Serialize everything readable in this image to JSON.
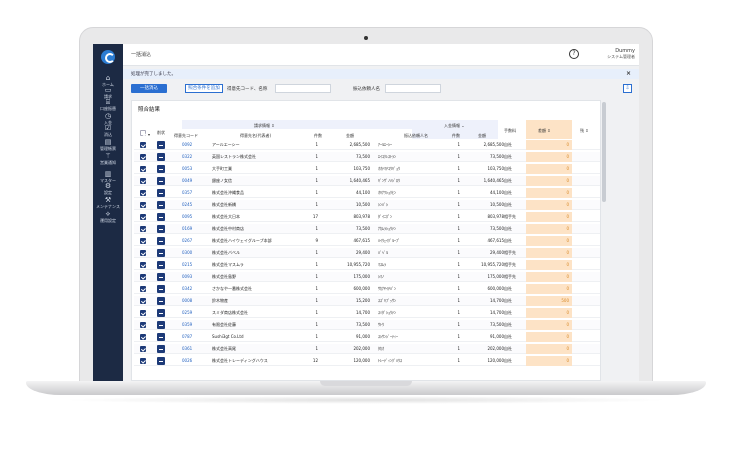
{
  "header": {
    "title": "一括消込",
    "user_name": "Dummy",
    "user_role": "システム管理者",
    "help_icon": "?"
  },
  "sidebar": [
    {
      "icon": "home-icon",
      "glyph": "⌂",
      "label": "ホーム"
    },
    {
      "icon": "invoice-icon",
      "glyph": "▭",
      "label": "請求"
    },
    {
      "icon": "bank-icon",
      "glyph": "⌸",
      "label": "口座振替"
    },
    {
      "icon": "deposit-icon",
      "glyph": "◷",
      "label": "入金"
    },
    {
      "icon": "clear-icon",
      "glyph": "☑",
      "label": "消込"
    },
    {
      "icon": "ledger-icon",
      "glyph": "▤",
      "label": "管理帳票"
    },
    {
      "icon": "notice-icon",
      "glyph": "⚚",
      "label": "営業通知"
    },
    {
      "icon": "master-icon",
      "glyph": "▥",
      "label": "マスター"
    },
    {
      "icon": "settings-icon",
      "glyph": "⚙",
      "label": "設定"
    },
    {
      "icon": "maintenance-icon",
      "glyph": "⚒",
      "label": "メンテナンス"
    },
    {
      "icon": "ops-icon",
      "glyph": "⟡",
      "label": "運用設定"
    }
  ],
  "alert": {
    "message": "処理が完了しました。",
    "close": "×"
  },
  "toolbar": {
    "bulk_clear": "一括消込",
    "add_condition": "照合条件を追加",
    "customer_label": "得意先コード、名称",
    "payer_label": "振込依頼人名",
    "download_icon": "⇩"
  },
  "results": {
    "title": "照合結果",
    "group_request": "請求情報 ⇕",
    "group_deposit": "入金情報 ⌄",
    "columns": {
      "select": "",
      "status": "削状",
      "code": "得意先コード",
      "name": "得意先名(代表者)",
      "count": "件数",
      "amount": "金額",
      "payer": "振込依頼人名",
      "dep_count": "件数",
      "dep_amount": "金額",
      "fee": "手数料",
      "diff": "差額 ⇕",
      "extra": "残 ⇕"
    },
    "rows": [
      {
        "code": "0092",
        "name": "アールエーシー",
        "count": "1",
        "amount": "2,685,500",
        "payer": "ｱｰﾙｴｰｼｰ",
        "dep_count": "1",
        "dep_amount": "2,685,500",
        "fee": "自社",
        "diff": "0"
      },
      {
        "code": "0322",
        "name": "英国レストラン株式会社",
        "count": "1",
        "amount": "73,500",
        "payer": "ｴｲｺｸﾚｽﾄﾗﾝ",
        "dep_count": "1",
        "dep_amount": "73,500",
        "fee": "自社",
        "diff": "0"
      },
      {
        "code": "0053",
        "name": "大手町工業",
        "count": "1",
        "amount": "103,750",
        "payer": "ｵｵﾃﾏﾁｺｳｷﾞｮｳ",
        "dep_count": "1",
        "dep_amount": "103,750",
        "fee": "自社",
        "diff": "0"
      },
      {
        "code": "0049",
        "name": "銀座ノ女信",
        "count": "1",
        "amount": "1,640,465",
        "payer": "ｷﾞﾝｻﾞﾉﾒｼﾞﾛｳ",
        "dep_count": "1",
        "dep_amount": "1,640,465",
        "fee": "自社",
        "diff": "0"
      },
      {
        "code": "0357",
        "name": "株式会社沖縄食品",
        "count": "1",
        "amount": "44,100",
        "payer": "ｵｷﾅﾜｼｮｸﾋﾝ",
        "dep_count": "1",
        "dep_amount": "44,100",
        "fee": "自社",
        "diff": "0"
      },
      {
        "code": "0245",
        "name": "株式会社新橋",
        "count": "1",
        "amount": "10,500",
        "payer": "ｼﾝﾊﾞｼ",
        "dep_count": "1",
        "dep_amount": "10,500",
        "fee": "自社",
        "diff": "0"
      },
      {
        "code": "0095",
        "name": "株式会社大日本",
        "count": "17",
        "amount": "803,978",
        "payer": "ﾀﾞｲﾆﾎﾟﾝ",
        "dep_count": "1",
        "dep_amount": "803,978",
        "fee": "相手先",
        "diff": "0"
      },
      {
        "code": "0169",
        "name": "株式会社中村商店",
        "count": "1",
        "amount": "73,500",
        "payer": "ﾅｶﾑﾗｼｮｳﾃﾝ",
        "dep_count": "1",
        "dep_amount": "73,500",
        "fee": "自社",
        "diff": "0"
      },
      {
        "code": "0267",
        "name": "株式会社ハイウェイグループ本部",
        "count": "9",
        "amount": "467,615",
        "payer": "ﾊｲｳｪｲｸﾞﾙｰﾌﾟ",
        "dep_count": "1",
        "dep_amount": "467,615",
        "fee": "自社",
        "diff": "0"
      },
      {
        "code": "0300",
        "name": "株式会社バベル",
        "count": "1",
        "amount": "29,400",
        "payer": "ﾊﾞﾍﾞﾙ",
        "dep_count": "1",
        "dep_amount": "29,400",
        "fee": "相手先",
        "diff": "0"
      },
      {
        "code": "0215",
        "name": "株式会社マスムラ",
        "count": "1",
        "amount": "10,955,720",
        "payer": "ﾏｽﾑﾗ",
        "dep_count": "1",
        "dep_amount": "10,955,720",
        "fee": "相手先",
        "diff": "0"
      },
      {
        "code": "0093",
        "name": "株式会社島野",
        "count": "1",
        "amount": "175,000",
        "payer": "ｼﾏﾉ",
        "dep_count": "1",
        "dep_amount": "175,000",
        "fee": "相手先",
        "diff": "0"
      },
      {
        "code": "0342",
        "name": "さかなや一番株式会社",
        "count": "1",
        "amount": "600,000",
        "payer": "ｻｶﾅﾔｲﾁﾊﾞﾝ",
        "dep_count": "1",
        "dep_amount": "600,000",
        "fee": "自社",
        "diff": "0"
      },
      {
        "code": "0008",
        "name": "鈴木物産",
        "count": "1",
        "amount": "15,200",
        "payer": "ｽｽﾞｷﾌﾞｯｻﾝ",
        "dep_count": "1",
        "dep_amount": "14,700",
        "fee": "自社",
        "diff": "500"
      },
      {
        "code": "0259",
        "name": "スミダ商店株式会社",
        "count": "1",
        "amount": "14,700",
        "payer": "ｽﾐﾀﾞｼｮｳﾃﾝ",
        "dep_count": "1",
        "dep_amount": "14,700",
        "fee": "自社",
        "diff": "0"
      },
      {
        "code": "0359",
        "name": "有限会社佐藤",
        "count": "1",
        "amount": "73,500",
        "payer": "ｻﾄｳ",
        "dep_count": "1",
        "dep_amount": "73,500",
        "fee": "自社",
        "diff": "0"
      },
      {
        "code": "0787",
        "name": "Sushi3gt Co.Ltd",
        "count": "1",
        "amount": "91,000",
        "payer": "ｽｼｻﾝｼﾞｰﾃｨｰ",
        "dep_count": "1",
        "dep_amount": "91,000",
        "fee": "自社",
        "diff": "0"
      },
      {
        "code": "0361",
        "name": "株式会社高尾",
        "count": "1",
        "amount": "202,000",
        "payer": "ﾀｶｵ",
        "dep_count": "1",
        "dep_amount": "202,000",
        "fee": "自社",
        "diff": "0"
      },
      {
        "code": "0026",
        "name": "株式会社トレーディングハウス",
        "count": "12",
        "amount": "120,000",
        "payer": "ﾄﾚｰﾃﾞｨﾝｸﾞﾊｳｽ",
        "dep_count": "1",
        "dep_amount": "120,000",
        "fee": "自社",
        "diff": "0"
      }
    ]
  }
}
